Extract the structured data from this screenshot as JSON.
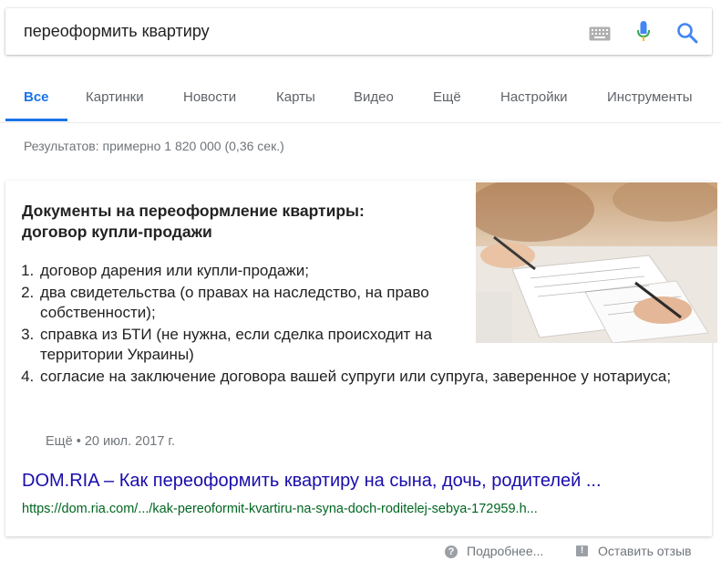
{
  "search": {
    "query": "переоформить квартиру",
    "icons": [
      "keyboard-icon",
      "mic-icon",
      "search-icon"
    ]
  },
  "tabs": [
    {
      "label": "Все",
      "active": true
    },
    {
      "label": "Картинки"
    },
    {
      "label": "Новости"
    },
    {
      "label": "Карты"
    },
    {
      "label": "Видео"
    },
    {
      "label": "Ещё"
    },
    {
      "label": "Настройки"
    },
    {
      "label": "Инструменты"
    }
  ],
  "stats": "Результатов: примерно 1 820 000 (0,36 сек.)",
  "snippet": {
    "heading_line1": "Документы на переоформление квартиры:",
    "heading_line2": "договор купли-продажи",
    "items": [
      "договор дарения или купли-продажи;",
      "два свидетельства (о правах на наследство, на право собственности);",
      "справка из БТИ (не нужна, если сделка происходит на территории Украины)",
      "согласие на заключение договора вашей супруги или супруга, заверенное у нотариуса;"
    ],
    "more": "Ещё",
    "date": "20 июл. 2017 г.",
    "meta_sep": "•",
    "link_title": "DOM.RIA – Как переоформить квартиру на сына, дочь, родителей ...",
    "url": "https://dom.ria.com/.../kak-pereoformit-kvartiru-na-syna-doch-roditelej-sebya-172959.h..."
  },
  "footer": {
    "more_label": "Подробнее...",
    "feedback_label": "Оставить отзыв"
  },
  "colors": {
    "accent": "#1a73e8",
    "link": "#1a0dab",
    "url": "#006621",
    "muted": "#70757a"
  }
}
